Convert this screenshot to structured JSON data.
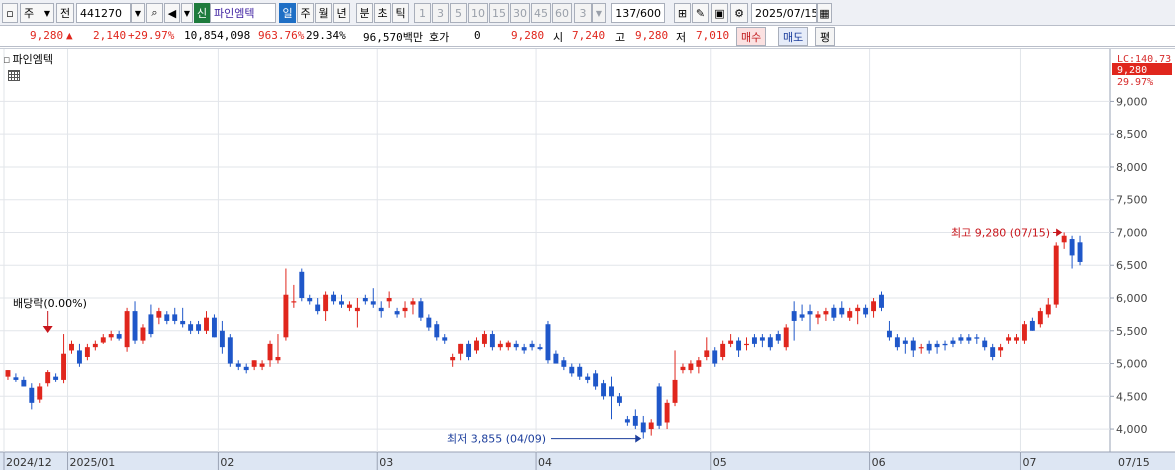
{
  "toolbar": {
    "mode": "주",
    "scope": "전",
    "code": "441270",
    "market_badge": "신",
    "stock_name": "파인엠텍",
    "periods": [
      "일",
      "주",
      "월",
      "년",
      "분",
      "초",
      "틱"
    ],
    "active_period": "일",
    "intervals": [
      "1",
      "3",
      "5",
      "10",
      "15",
      "30",
      "45",
      "60"
    ],
    "interval_value": "3",
    "count": "137/600",
    "date": "2025/07/15"
  },
  "quote": {
    "price": "9,280",
    "change": "2,140",
    "change_pct": "+29.97%",
    "volume": "10,854,098",
    "volume_ratio": "963.76%",
    "turnover": "29.34%",
    "amount": "96,570백만",
    "bid_label": "호가",
    "bid_value": "0",
    "bid_price": "9,280",
    "open_label": "시",
    "open": "7,240",
    "high_label": "고",
    "high": "9,280",
    "low_label": "저",
    "low": "7,010",
    "buy_label": "매수",
    "sell_label": "매도",
    "extra_label": "평"
  },
  "chart": {
    "stock_label": "파인엠텍",
    "lc_label": "LC:140.73",
    "last_price_tag": "9,280",
    "last_pct_tag": "29.97%",
    "high_annotation": "최고 9,280 (07/15)",
    "low_annotation": "최저 3,855 (04/09)",
    "dividend_annotation": "배당락(0.00%)",
    "up_color": "#e0261d",
    "down_color": "#1f57c9"
  },
  "chart_data": {
    "type": "candlestick",
    "ylim": [
      3650,
      9800
    ],
    "y_ticks": [
      4000,
      4500,
      5000,
      5500,
      6000,
      6500,
      7000,
      7500,
      8000,
      8500,
      9000
    ],
    "y_tick_labels": [
      "4,000",
      "4,500",
      "5,000",
      "5,500",
      "6,000",
      "6,500",
      "7,000",
      "7,500",
      "8,000",
      "8,500",
      "9,000"
    ],
    "x_tick_labels": [
      "2024/12",
      "2025/01",
      "02",
      "03",
      "04",
      "05",
      "06",
      "07",
      "07/15"
    ],
    "x_tick_index": [
      0,
      8,
      27,
      47,
      67,
      89,
      109,
      128,
      136
    ],
    "candles": [
      {
        "o": 4800,
        "h": 4900,
        "l": 4750,
        "c": 4900
      },
      {
        "o": 4790,
        "h": 4850,
        "l": 4720,
        "c": 4750
      },
      {
        "o": 4750,
        "h": 4800,
        "l": 4650,
        "c": 4650
      },
      {
        "o": 4630,
        "h": 4700,
        "l": 4300,
        "c": 4400
      },
      {
        "o": 4450,
        "h": 4700,
        "l": 4400,
        "c": 4650
      },
      {
        "o": 4700,
        "h": 4900,
        "l": 4650,
        "c": 4870
      },
      {
        "o": 4800,
        "h": 4850,
        "l": 4720,
        "c": 4750
      },
      {
        "o": 4750,
        "h": 5450,
        "l": 4700,
        "c": 5150
      },
      {
        "o": 5200,
        "h": 5350,
        "l": 5150,
        "c": 5300
      },
      {
        "o": 5200,
        "h": 5300,
        "l": 4950,
        "c": 5000
      },
      {
        "o": 5100,
        "h": 5300,
        "l": 5050,
        "c": 5250
      },
      {
        "o": 5250,
        "h": 5350,
        "l": 5200,
        "c": 5300
      },
      {
        "o": 5320,
        "h": 5450,
        "l": 5300,
        "c": 5400
      },
      {
        "o": 5400,
        "h": 5500,
        "l": 5350,
        "c": 5450
      },
      {
        "o": 5450,
        "h": 5500,
        "l": 5350,
        "c": 5380
      },
      {
        "o": 5250,
        "h": 5850,
        "l": 5180,
        "c": 5800
      },
      {
        "o": 5800,
        "h": 5950,
        "l": 5300,
        "c": 5350
      },
      {
        "o": 5350,
        "h": 5600,
        "l": 5300,
        "c": 5550
      },
      {
        "o": 5750,
        "h": 5900,
        "l": 5400,
        "c": 5450
      },
      {
        "o": 5700,
        "h": 5850,
        "l": 5600,
        "c": 5800
      },
      {
        "o": 5750,
        "h": 5800,
        "l": 5600,
        "c": 5650
      },
      {
        "o": 5750,
        "h": 5850,
        "l": 5600,
        "c": 5650
      },
      {
        "o": 5650,
        "h": 5850,
        "l": 5550,
        "c": 5600
      },
      {
        "o": 5600,
        "h": 5650,
        "l": 5450,
        "c": 5500
      },
      {
        "o": 5600,
        "h": 5650,
        "l": 5450,
        "c": 5500
      },
      {
        "o": 5500,
        "h": 5800,
        "l": 5450,
        "c": 5700
      },
      {
        "o": 5700,
        "h": 5750,
        "l": 5400,
        "c": 5400
      },
      {
        "o": 5500,
        "h": 5650,
        "l": 5150,
        "c": 5250
      },
      {
        "o": 5400,
        "h": 5450,
        "l": 4950,
        "c": 5000
      },
      {
        "o": 5000,
        "h": 5050,
        "l": 4900,
        "c": 4950
      },
      {
        "o": 4950,
        "h": 5000,
        "l": 4850,
        "c": 4900
      },
      {
        "o": 4950,
        "h": 5050,
        "l": 4900,
        "c": 5050
      },
      {
        "o": 4950,
        "h": 5050,
        "l": 4900,
        "c": 5000
      },
      {
        "o": 5050,
        "h": 5350,
        "l": 4950,
        "c": 5300
      },
      {
        "o": 5050,
        "h": 5450,
        "l": 5000,
        "c": 5100
      },
      {
        "o": 5400,
        "h": 6450,
        "l": 5350,
        "c": 6050
      },
      {
        "o": 5950,
        "h": 6200,
        "l": 5850,
        "c": 5950
      },
      {
        "o": 6400,
        "h": 6450,
        "l": 5950,
        "c": 6000
      },
      {
        "o": 6000,
        "h": 6050,
        "l": 5900,
        "c": 5950
      },
      {
        "o": 5900,
        "h": 6000,
        "l": 5750,
        "c": 5800
      },
      {
        "o": 5800,
        "h": 6100,
        "l": 5650,
        "c": 6050
      },
      {
        "o": 6050,
        "h": 6100,
        "l": 5900,
        "c": 5950
      },
      {
        "o": 5950,
        "h": 6050,
        "l": 5850,
        "c": 5900
      },
      {
        "o": 5850,
        "h": 5950,
        "l": 5800,
        "c": 5900
      },
      {
        "o": 5800,
        "h": 6000,
        "l": 5550,
        "c": 5850
      },
      {
        "o": 6000,
        "h": 6050,
        "l": 5900,
        "c": 5950
      },
      {
        "o": 5950,
        "h": 6150,
        "l": 5850,
        "c": 5900
      },
      {
        "o": 5850,
        "h": 5950,
        "l": 5700,
        "c": 5800
      },
      {
        "o": 5950,
        "h": 6100,
        "l": 5850,
        "c": 6000
      },
      {
        "o": 5800,
        "h": 5850,
        "l": 5700,
        "c": 5750
      },
      {
        "o": 5800,
        "h": 5950,
        "l": 5700,
        "c": 5850
      },
      {
        "o": 5900,
        "h": 6000,
        "l": 5750,
        "c": 5950
      },
      {
        "o": 5950,
        "h": 6000,
        "l": 5650,
        "c": 5700
      },
      {
        "o": 5700,
        "h": 5750,
        "l": 5500,
        "c": 5550
      },
      {
        "o": 5600,
        "h": 5650,
        "l": 5350,
        "c": 5400
      },
      {
        "o": 5400,
        "h": 5450,
        "l": 5300,
        "c": 5350
      },
      {
        "o": 5050,
        "h": 5150,
        "l": 4950,
        "c": 5100
      },
      {
        "o": 5150,
        "h": 5300,
        "l": 5050,
        "c": 5300
      },
      {
        "o": 5300,
        "h": 5350,
        "l": 5050,
        "c": 5100
      },
      {
        "o": 5200,
        "h": 5400,
        "l": 5150,
        "c": 5350
      },
      {
        "o": 5300,
        "h": 5500,
        "l": 5250,
        "c": 5450
      },
      {
        "o": 5450,
        "h": 5500,
        "l": 5200,
        "c": 5250
      },
      {
        "o": 5250,
        "h": 5350,
        "l": 5200,
        "c": 5300
      },
      {
        "o": 5250,
        "h": 5350,
        "l": 5200,
        "c": 5320
      },
      {
        "o": 5300,
        "h": 5350,
        "l": 5200,
        "c": 5250
      },
      {
        "o": 5250,
        "h": 5300,
        "l": 5150,
        "c": 5200
      },
      {
        "o": 5300,
        "h": 5350,
        "l": 5200,
        "c": 5250
      },
      {
        "o": 5250,
        "h": 5300,
        "l": 5200,
        "c": 5220
      },
      {
        "o": 5600,
        "h": 5650,
        "l": 5000,
        "c": 5050
      },
      {
        "o": 5150,
        "h": 5200,
        "l": 5000,
        "c": 5000
      },
      {
        "o": 5050,
        "h": 5100,
        "l": 4900,
        "c": 4950
      },
      {
        "o": 4950,
        "h": 5000,
        "l": 4800,
        "c": 4850
      },
      {
        "o": 4950,
        "h": 5000,
        "l": 4750,
        "c": 4800
      },
      {
        "o": 4800,
        "h": 4850,
        "l": 4700,
        "c": 4750
      },
      {
        "o": 4850,
        "h": 4900,
        "l": 4600,
        "c": 4650
      },
      {
        "o": 4700,
        "h": 4750,
        "l": 4450,
        "c": 4500
      },
      {
        "o": 4650,
        "h": 4800,
        "l": 4150,
        "c": 4500
      },
      {
        "o": 4500,
        "h": 4550,
        "l": 4350,
        "c": 4400
      },
      {
        "o": 4150,
        "h": 4200,
        "l": 4050,
        "c": 4100
      },
      {
        "o": 4200,
        "h": 4300,
        "l": 4000,
        "c": 4050
      },
      {
        "o": 4100,
        "h": 4200,
        "l": 3855,
        "c": 3950
      },
      {
        "o": 4000,
        "h": 4150,
        "l": 3900,
        "c": 4100
      },
      {
        "o": 4650,
        "h": 4700,
        "l": 4000,
        "c": 4050
      },
      {
        "o": 4100,
        "h": 4450,
        "l": 4000,
        "c": 4400
      },
      {
        "o": 4400,
        "h": 5200,
        "l": 4350,
        "c": 4750
      },
      {
        "o": 4900,
        "h": 5000,
        "l": 4850,
        "c": 4950
      },
      {
        "o": 4900,
        "h": 5050,
        "l": 4850,
        "c": 5000
      },
      {
        "o": 4950,
        "h": 5100,
        "l": 4850,
        "c": 5050
      },
      {
        "o": 5100,
        "h": 5400,
        "l": 5050,
        "c": 5200
      },
      {
        "o": 5200,
        "h": 5250,
        "l": 4950,
        "c": 5000
      },
      {
        "o": 5100,
        "h": 5350,
        "l": 5050,
        "c": 5300
      },
      {
        "o": 5300,
        "h": 5450,
        "l": 5250,
        "c": 5350
      },
      {
        "o": 5350,
        "h": 5400,
        "l": 5100,
        "c": 5200
      },
      {
        "o": 5300,
        "h": 5400,
        "l": 5200,
        "c": 5300
      },
      {
        "o": 5400,
        "h": 5450,
        "l": 5250,
        "c": 5300
      },
      {
        "o": 5400,
        "h": 5450,
        "l": 5250,
        "c": 5350
      },
      {
        "o": 5400,
        "h": 5450,
        "l": 5200,
        "c": 5250
      },
      {
        "o": 5450,
        "h": 5500,
        "l": 5300,
        "c": 5350
      },
      {
        "o": 5250,
        "h": 5600,
        "l": 5200,
        "c": 5550
      },
      {
        "o": 5800,
        "h": 5950,
        "l": 5350,
        "c": 5650
      },
      {
        "o": 5750,
        "h": 5900,
        "l": 5650,
        "c": 5700
      },
      {
        "o": 5800,
        "h": 5900,
        "l": 5500,
        "c": 5750
      },
      {
        "o": 5700,
        "h": 5800,
        "l": 5600,
        "c": 5750
      },
      {
        "o": 5750,
        "h": 5850,
        "l": 5650,
        "c": 5800
      },
      {
        "o": 5850,
        "h": 5900,
        "l": 5650,
        "c": 5700
      },
      {
        "o": 5850,
        "h": 5950,
        "l": 5700,
        "c": 5750
      },
      {
        "o": 5700,
        "h": 5850,
        "l": 5650,
        "c": 5800
      },
      {
        "o": 5800,
        "h": 5900,
        "l": 5600,
        "c": 5850
      },
      {
        "o": 5850,
        "h": 5900,
        "l": 5700,
        "c": 5750
      },
      {
        "o": 5800,
        "h": 6000,
        "l": 5700,
        "c": 5950
      },
      {
        "o": 6050,
        "h": 6100,
        "l": 5800,
        "c": 5850
      },
      {
        "o": 5500,
        "h": 5650,
        "l": 5350,
        "c": 5400
      },
      {
        "o": 5400,
        "h": 5450,
        "l": 5200,
        "c": 5250
      },
      {
        "o": 5350,
        "h": 5400,
        "l": 5150,
        "c": 5300
      },
      {
        "o": 5350,
        "h": 5400,
        "l": 5100,
        "c": 5200
      },
      {
        "o": 5250,
        "h": 5300,
        "l": 5150,
        "c": 5250
      },
      {
        "o": 5300,
        "h": 5350,
        "l": 5150,
        "c": 5200
      },
      {
        "o": 5300,
        "h": 5350,
        "l": 5150,
        "c": 5250
      },
      {
        "o": 5300,
        "h": 5350,
        "l": 5200,
        "c": 5280
      },
      {
        "o": 5350,
        "h": 5400,
        "l": 5250,
        "c": 5300
      },
      {
        "o": 5400,
        "h": 5450,
        "l": 5300,
        "c": 5350
      },
      {
        "o": 5400,
        "h": 5450,
        "l": 5300,
        "c": 5350
      },
      {
        "o": 5400,
        "h": 5450,
        "l": 5300,
        "c": 5380
      },
      {
        "o": 5350,
        "h": 5400,
        "l": 5200,
        "c": 5250
      },
      {
        "o": 5250,
        "h": 5300,
        "l": 5050,
        "c": 5100
      },
      {
        "o": 5200,
        "h": 5300,
        "l": 5100,
        "c": 5250
      },
      {
        "o": 5350,
        "h": 5450,
        "l": 5300,
        "c": 5400
      },
      {
        "o": 5350,
        "h": 5450,
        "l": 5300,
        "c": 5400
      },
      {
        "o": 5350,
        "h": 5650,
        "l": 5300,
        "c": 5600
      },
      {
        "o": 5650,
        "h": 5700,
        "l": 5500,
        "c": 5500
      },
      {
        "o": 5600,
        "h": 5850,
        "l": 5550,
        "c": 5800
      },
      {
        "o": 5750,
        "h": 6000,
        "l": 5700,
        "c": 5900
      },
      {
        "o": 5900,
        "h": 6850,
        "l": 5850,
        "c": 6800
      },
      {
        "o": 6850,
        "h": 7000,
        "l": 6750,
        "c": 6950
      },
      {
        "o": 6900,
        "h": 6950,
        "l": 6450,
        "c": 6650
      },
      {
        "o": 6850,
        "h": 6950,
        "l": 6500,
        "c": 6550
      }
    ]
  }
}
